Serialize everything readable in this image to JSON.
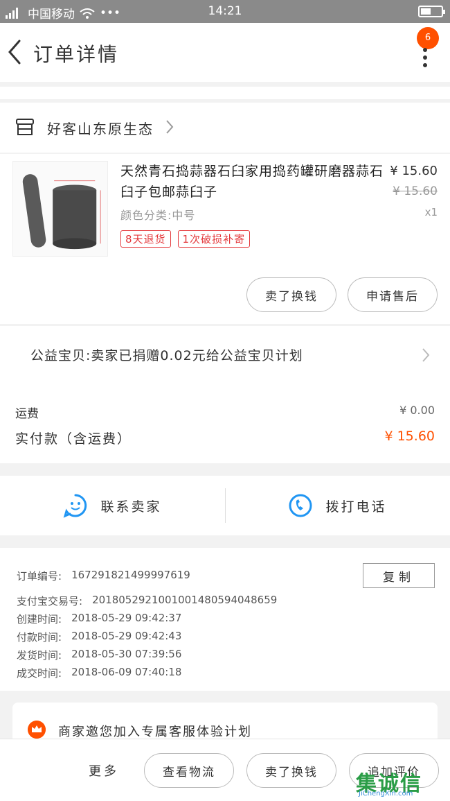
{
  "status_bar": {
    "carrier": "中国移动",
    "time": "14:21",
    "dots": "•••"
  },
  "nav": {
    "title": "订单详情",
    "badge": "6"
  },
  "shop": {
    "name": "好客山东原生态"
  },
  "item": {
    "name": "天然青石捣蒜器石臼家用捣药罐研磨器蒜石臼子包邮蒜臼子",
    "spec": "颜色分类:中号",
    "price": "¥ 15.60",
    "original_price": "¥ 15.60",
    "quantity": "x1",
    "tags": [
      "8天退货",
      "1次破损补寄"
    ],
    "buttons": {
      "buy_again": "卖了换钱",
      "after_sale": "申请售后"
    }
  },
  "charity": {
    "text": "公益宝贝:卖家已捐赠0.02元给公益宝贝计划"
  },
  "payment": {
    "shipping_label": "运费",
    "shipping_value": "¥ 0.00",
    "paid_label": "实付款（含运费）",
    "paid_value": "¥ 15.60"
  },
  "contact": {
    "seller": "联系卖家",
    "phone": "拨打电话"
  },
  "order_info": {
    "copy": "复制",
    "rows": [
      {
        "label": "订单编号:",
        "value": "167291821499997619"
      },
      {
        "label": "支付宝交易号:",
        "value": "2018052921001001480594048659"
      },
      {
        "label": "创建时间:",
        "value": "2018-05-29 09:42:37"
      },
      {
        "label": "付款时间:",
        "value": "2018-05-29 09:42:43"
      },
      {
        "label": "发货时间:",
        "value": "2018-05-30 07:39:56"
      },
      {
        "label": "成交时间:",
        "value": "2018-06-09 07:40:18"
      }
    ]
  },
  "promo": {
    "text": "商家邀您加入专属客服体验计划"
  },
  "bottom": {
    "more": "更多",
    "logistics": "查看物流",
    "sell": "卖了换钱",
    "review": "追加评价"
  },
  "watermark": {
    "logo": "集诚信",
    "url": "JiChengXin.com"
  },
  "colors": {
    "accent": "#ff5000",
    "tag": "#e4393c",
    "icon_blue": "#2196f3"
  }
}
